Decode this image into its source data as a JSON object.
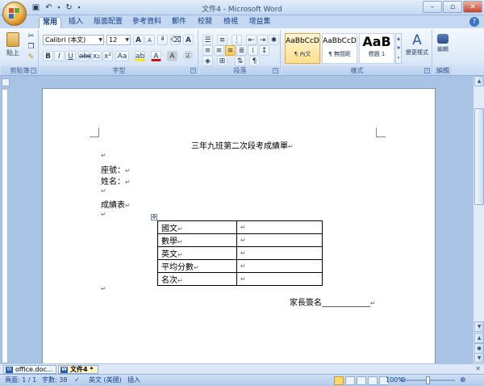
{
  "window": {
    "title": "文件4 - Microsoft Word"
  },
  "quick_access": {
    "save_icon": "save-icon",
    "undo_icon": "undo-icon",
    "redo_icon": "redo-icon"
  },
  "tabs": [
    {
      "label": "常用",
      "active": true
    },
    {
      "label": "插入"
    },
    {
      "label": "版面配置"
    },
    {
      "label": "參考資料"
    },
    {
      "label": "郵件"
    },
    {
      "label": "校閱"
    },
    {
      "label": "檢視"
    },
    {
      "label": "增益集"
    }
  ],
  "ribbon": {
    "clipboard": {
      "label": "剪貼簿",
      "paste": "貼上"
    },
    "font": {
      "label": "字型",
      "font_name": "Calibri (本文)",
      "font_size": "12"
    },
    "paragraph": {
      "label": "段落"
    },
    "styles": {
      "label": "樣式",
      "items": [
        {
          "sample": "AaBbCcD",
          "name": "¶ 內文"
        },
        {
          "sample": "AaBbCcD",
          "name": "¶ 無間距"
        },
        {
          "sample": "AaB",
          "name": "標題 1"
        }
      ],
      "change_styles": "變更樣式"
    },
    "editing": {
      "label": "編輯",
      "button": "編輯"
    }
  },
  "document": {
    "title": "三年九班第二次段考成績單",
    "seat_label": "座號：",
    "name_label": "姓名：",
    "report_label": "成績表",
    "table_rows": [
      "國文",
      "數學",
      "英文",
      "平均分數",
      "名次"
    ],
    "signature": "家長簽名____________"
  },
  "doc_tabs": [
    {
      "label": "office.doc..."
    },
    {
      "label": "文件4 *",
      "active": true
    }
  ],
  "status": {
    "page": "頁面: 1 / 1",
    "words": "字數: 38",
    "language": "英文 (美國)",
    "mode": "插入",
    "zoom": "100%"
  },
  "colors": {
    "accent": "#15428b",
    "ribbon_bg": "#dbe8f7",
    "workspace": "#a9c3e4"
  }
}
